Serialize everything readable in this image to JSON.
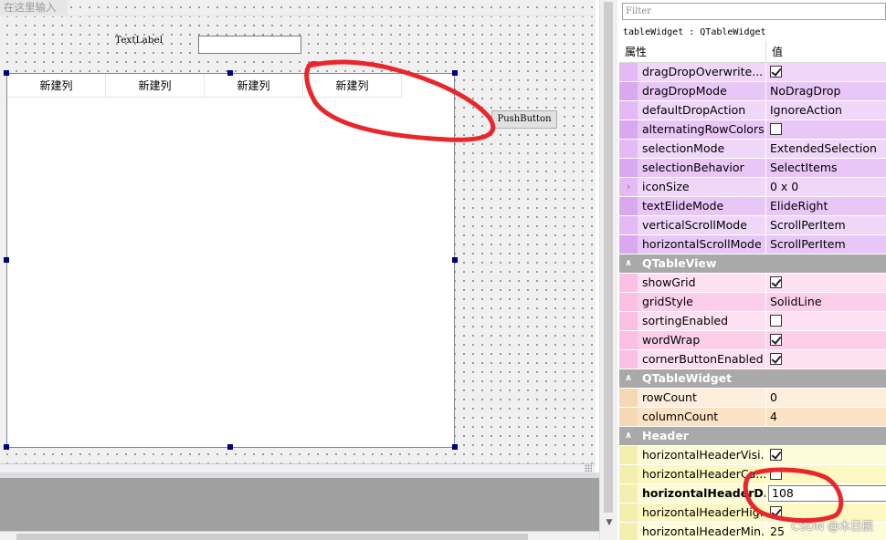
{
  "designer": {
    "menu_hint": "在这里输入",
    "text_label": "TextLabel",
    "push_button": "PushButton",
    "table_headers": [
      "新建列",
      "新建列",
      "新建列",
      "新建列"
    ]
  },
  "property_editor": {
    "filter_placeholder": "Filter",
    "object_label": "tableWidget : QTableWidget",
    "col_property": "属性",
    "col_value": "值",
    "groups": [
      {
        "name": "",
        "theme": "purple",
        "rows": [
          {
            "name": "dragDropOverwrite...",
            "type": "checkbox",
            "checked": true
          },
          {
            "name": "dragDropMode",
            "type": "text",
            "value": "NoDragDrop"
          },
          {
            "name": "defaultDropAction",
            "type": "text",
            "value": "IgnoreAction"
          },
          {
            "name": "alternatingRowColors",
            "type": "checkbox",
            "checked": false
          },
          {
            "name": "selectionMode",
            "type": "text",
            "value": "ExtendedSelection"
          },
          {
            "name": "selectionBehavior",
            "type": "text",
            "value": "SelectItems"
          },
          {
            "name": "iconSize",
            "type": "text",
            "value": "0 x 0",
            "expandable": true
          },
          {
            "name": "textElideMode",
            "type": "text",
            "value": "ElideRight"
          },
          {
            "name": "verticalScrollMode",
            "type": "text",
            "value": "ScrollPerItem"
          },
          {
            "name": "horizontalScrollMode",
            "type": "text",
            "value": "ScrollPerItem"
          }
        ]
      },
      {
        "name": "QTableView",
        "theme": "pink",
        "rows": [
          {
            "name": "showGrid",
            "type": "checkbox",
            "checked": true
          },
          {
            "name": "gridStyle",
            "type": "text",
            "value": "SolidLine"
          },
          {
            "name": "sortingEnabled",
            "type": "checkbox",
            "checked": false
          },
          {
            "name": "wordWrap",
            "type": "checkbox",
            "checked": true
          },
          {
            "name": "cornerButtonEnabled",
            "type": "checkbox",
            "checked": true
          }
        ]
      },
      {
        "name": "QTableWidget",
        "theme": "orange",
        "rows": [
          {
            "name": "rowCount",
            "type": "text",
            "value": "0"
          },
          {
            "name": "columnCount",
            "type": "text",
            "value": "4"
          }
        ]
      },
      {
        "name": "Header",
        "theme": "yellow",
        "rows": [
          {
            "name": "horizontalHeaderVisi...",
            "type": "checkbox",
            "checked": true
          },
          {
            "name": "horizontalHeaderCa...",
            "type": "checkbox",
            "checked": false
          },
          {
            "name": "horizontalHeaderD...",
            "type": "edit",
            "value": "108",
            "bold": true
          },
          {
            "name": "horizontalHeaderHig...",
            "type": "checkbox",
            "checked": true
          },
          {
            "name": "horizontalHeaderMin...",
            "type": "text",
            "value": "25"
          }
        ]
      }
    ]
  },
  "watermark": "CSDN @木日辰",
  "colors": {
    "annotation": "#e8262b",
    "handle": "#000080",
    "section_header": "#a9a9a9"
  }
}
